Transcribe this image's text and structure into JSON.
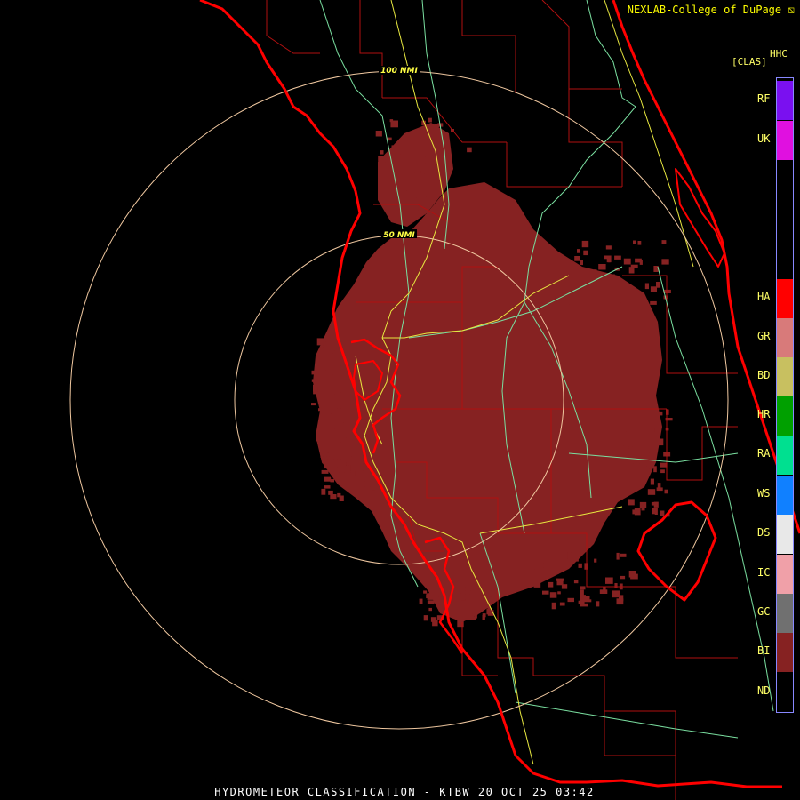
{
  "header": {
    "credit": "NEXLAB-College of DuPage",
    "product_code": "HHC",
    "units_label": "[CLAS]"
  },
  "footer": {
    "title": "HYDROMETEOR CLASSIFICATION - KTBW 20 OCT 25 03:42"
  },
  "range_rings": [
    {
      "label": "100 NMI"
    },
    {
      "label": "50 NMI"
    }
  ],
  "legend": {
    "classes": [
      {
        "code": "RF",
        "color": "#7a10f0"
      },
      {
        "code": "UK",
        "color": "#e010e0"
      },
      {
        "code": "HA",
        "color": "#ff0000"
      },
      {
        "code": "GR",
        "color": "#d87a7a"
      },
      {
        "code": "BD",
        "color": "#c8c060"
      },
      {
        "code": "HR",
        "color": "#00a000"
      },
      {
        "code": "RA",
        "color": "#00e090"
      },
      {
        "code": "WS",
        "color": "#1080ff"
      },
      {
        "code": "DS",
        "color": "#e8e8e8"
      },
      {
        "code": "IC",
        "color": "#f0a0a8"
      },
      {
        "code": "GC",
        "color": "#707070"
      },
      {
        "code": "BI",
        "color": "#862222"
      },
      {
        "code": "ND",
        "color": "#000000"
      }
    ]
  },
  "colors": {
    "echo_bi": "#862222",
    "coastline": "#ff0000",
    "county_lines": "#b01010",
    "highways_yellow": "#e8e840",
    "highways_green": "#7adfa0",
    "range_ring": "#f0c8a0"
  },
  "icons": [
    "logo-mark-icon"
  ]
}
